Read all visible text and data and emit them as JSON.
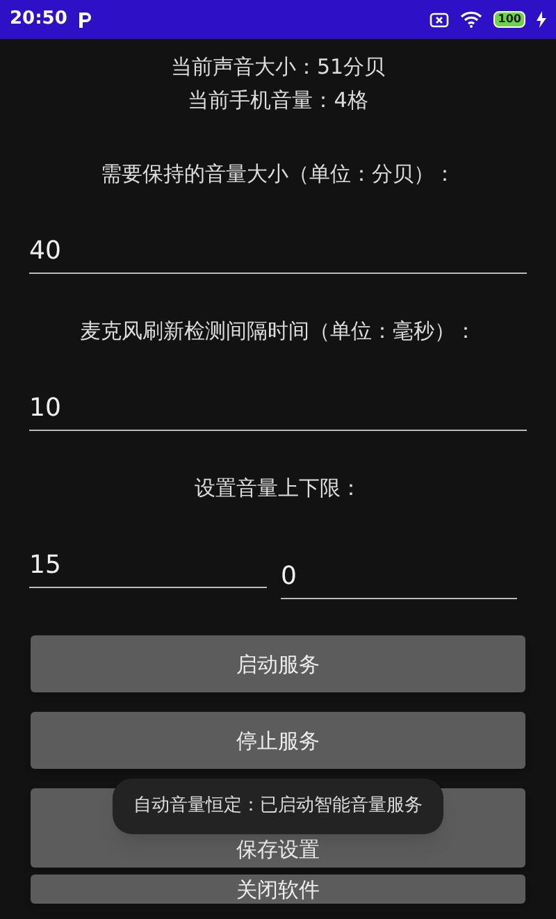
{
  "status_bar": {
    "time": "20:50",
    "battery": "100"
  },
  "readings": [
    "当前声音大小：51分贝",
    "当前手机音量：4格"
  ],
  "fields": [
    {
      "label": "需要保持的音量大小（单位：分贝）：",
      "values": [
        "40"
      ]
    },
    {
      "label": "麦克风刷新检测间隔时间（单位：毫秒）：",
      "values": [
        "10"
      ]
    },
    {
      "label": "设置音量上下限：",
      "values": [
        "15",
        "0"
      ]
    }
  ],
  "buttons": [
    "启动服务",
    "停止服务",
    "保存设置",
    "关闭软件"
  ],
  "toast": "自动音量恒定：已启动智能音量服务"
}
